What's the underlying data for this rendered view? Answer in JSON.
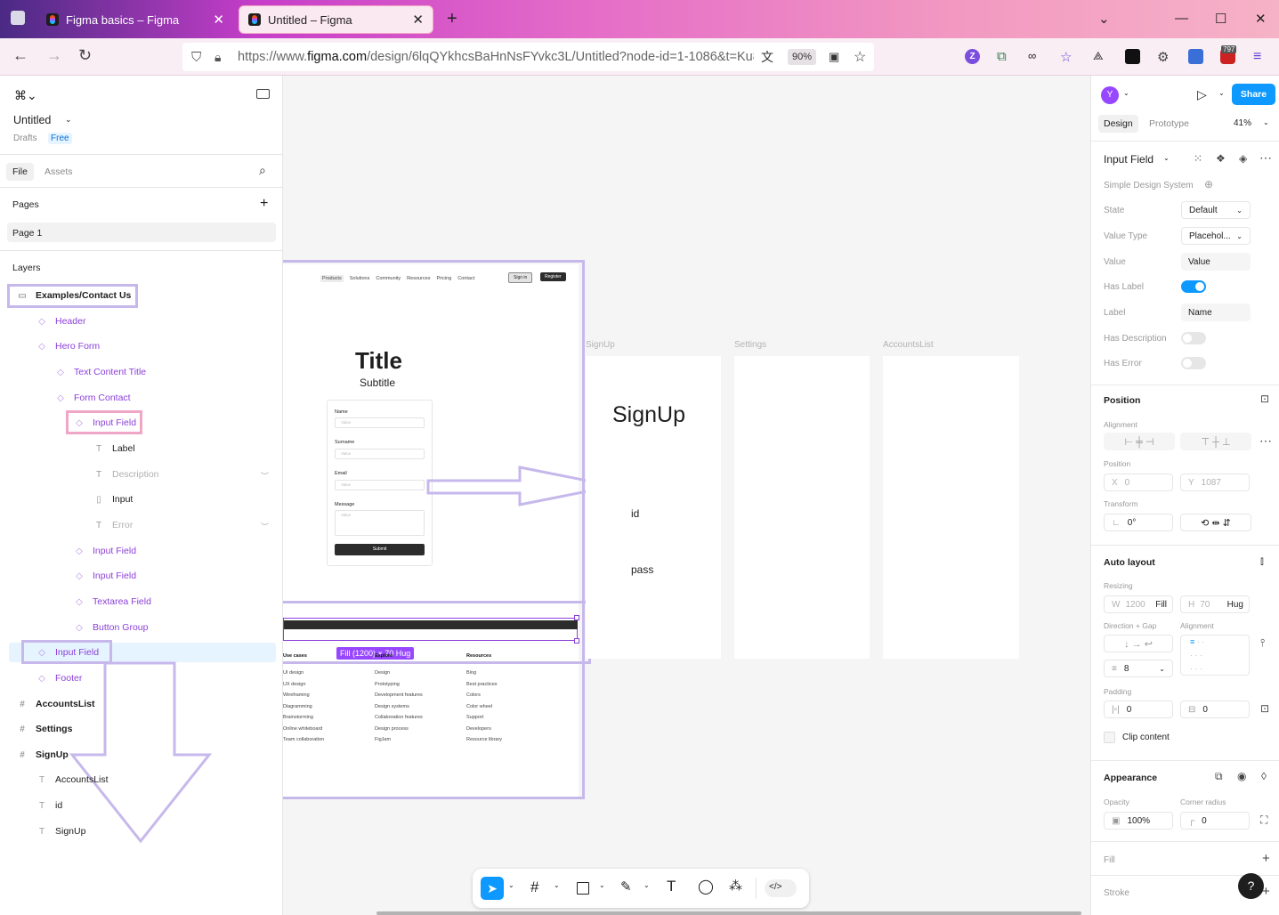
{
  "browser": {
    "tabs": [
      {
        "label": "Figma basics – Figma"
      },
      {
        "label": "Untitled – Figma"
      }
    ],
    "url_prefix": "https://www.",
    "url_host": "figma.com",
    "url_path": "/design/6lqQYkhcsBaHnNsFYvkc3L/Untitled?node-id=1-1086&t=Ku8Cm",
    "zoom": "90%",
    "badge": "797",
    "ext_letter": "Z"
  },
  "file": {
    "name": "Untitled",
    "location": "Drafts",
    "plan": "Free"
  },
  "left_tabs": {
    "file": "File",
    "assets": "Assets"
  },
  "pages": {
    "heading": "Pages",
    "items": [
      "Page 1"
    ]
  },
  "layers": {
    "heading": "Layers",
    "items": [
      {
        "label": "Examples/Contact Us",
        "icon": "▭"
      },
      {
        "label": "Header",
        "icon": "◇"
      },
      {
        "label": "Hero Form",
        "icon": "◇"
      },
      {
        "label": "Text Content Title",
        "icon": "◇"
      },
      {
        "label": "Form Contact",
        "icon": "◇"
      },
      {
        "label": "Input Field",
        "icon": "◇"
      },
      {
        "label": "Label",
        "icon": "T"
      },
      {
        "label": "Description",
        "icon": "T"
      },
      {
        "label": "Input",
        "icon": "▯"
      },
      {
        "label": "Error",
        "icon": "T"
      },
      {
        "label": "Input Field",
        "icon": "◇"
      },
      {
        "label": "Input Field",
        "icon": "◇"
      },
      {
        "label": "Textarea Field",
        "icon": "◇"
      },
      {
        "label": "Button Group",
        "icon": "◇"
      },
      {
        "label": "Input Field",
        "icon": "◇"
      },
      {
        "label": "Footer",
        "icon": "◇"
      },
      {
        "label": "AccountsList",
        "icon": "#"
      },
      {
        "label": "Settings",
        "icon": "#"
      },
      {
        "label": "SignUp",
        "icon": "#"
      },
      {
        "label": "AccountsList",
        "icon": "T"
      },
      {
        "label": "id",
        "icon": "T"
      },
      {
        "label": "SignUp",
        "icon": "T"
      }
    ]
  },
  "mock": {
    "nav": [
      "Products",
      "Solutions",
      "Community",
      "Resources",
      "Pricing",
      "Contact"
    ],
    "sign_in": "Sign in",
    "register": "Register",
    "title": "Title",
    "subtitle": "Subtitle",
    "fields": [
      {
        "label": "Name",
        "value": "Value"
      },
      {
        "label": "Surname",
        "value": "Value"
      },
      {
        "label": "Email",
        "value": "Value"
      },
      {
        "label": "Message",
        "value": "Value"
      }
    ],
    "submit": "Submit",
    "size_badge": "Fill (1200) × 70 Hug",
    "footer_cols": [
      {
        "head": "Use cases",
        "items": [
          "UI design",
          "UX design",
          "Wireframing",
          "Diagramming",
          "Brainstorming",
          "Online whiteboard",
          "Team collaboration"
        ]
      },
      {
        "head": "Explore",
        "items": [
          "Design",
          "Prototyping",
          "Development features",
          "Design systems",
          "Collaboration features",
          "Design process",
          "FigJam"
        ]
      },
      {
        "head": "Resources",
        "items": [
          "Blog",
          "Best practices",
          "Colors",
          "Color wheel",
          "Support",
          "Developers",
          "Resource library"
        ]
      }
    ]
  },
  "frames": {
    "signup": {
      "label": "SignUp",
      "title": "SignUp",
      "id": "id",
      "pass": "pass"
    },
    "settings": {
      "label": "Settings"
    },
    "accounts": {
      "label": "AccountsList"
    }
  },
  "right": {
    "avatar": "Y",
    "share": "Share",
    "tab_design": "Design",
    "tab_prototype": "Prototype",
    "zoom": "41%",
    "component": "Input Field",
    "library": "Simple Design System",
    "props": {
      "state_label": "State",
      "state": "Default",
      "vtype_label": "Value Type",
      "vtype": "Placehol...",
      "value_label": "Value",
      "value": "Value",
      "haslabel_label": "Has Label",
      "label_label": "Label",
      "label": "Name",
      "hasdesc_label": "Has Description",
      "haserror_label": "Has Error"
    },
    "position": {
      "heading": "Position",
      "alignment": "Alignment",
      "position": "Position",
      "x_label": "X",
      "x": "0",
      "y_label": "Y",
      "y": "1087",
      "transform": "Transform",
      "rotation": "0°"
    },
    "autolayout": {
      "heading": "Auto layout",
      "resizing": "Resizing",
      "w_label": "W",
      "w": "1200",
      "w_mode": "Fill",
      "h_label": "H",
      "h": "70",
      "h_mode": "Hug",
      "direction": "Direction + Gap",
      "alignment": "Alignment",
      "gap": "8",
      "padding": "Padding",
      "pad_h": "0",
      "pad_v": "0",
      "clip": "Clip content"
    },
    "appearance": {
      "heading": "Appearance",
      "opacity_label": "Opacity",
      "opacity": "100%",
      "radius_label": "Corner radius",
      "radius": "0"
    },
    "fill": "Fill",
    "stroke": "Stroke",
    "help": "?"
  },
  "colors": {
    "accent": "#0d99ff",
    "component": "#8b3fd9",
    "annotation": "#c7b8ec",
    "annotation_pink": "#f0a6c6"
  }
}
